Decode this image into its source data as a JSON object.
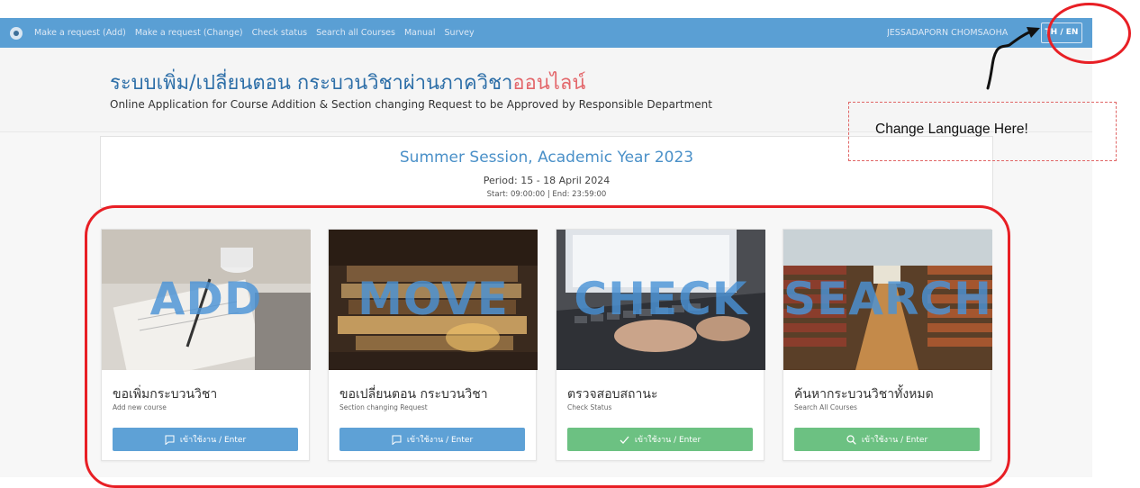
{
  "nav": {
    "links": [
      "Make a request (Add)",
      "Make a request (Change)",
      "Check status",
      "Search all Courses",
      "Manual",
      "Survey"
    ],
    "user": "JESSADAPORN CHOMSAOHA",
    "lang_th": "TH",
    "lang_sep": " / ",
    "lang_en": "EN"
  },
  "header": {
    "title_main": "ระบบเพิ่ม/เปลี่ยนตอน กระบวนวิชาผ่านภาควิชา",
    "title_accent": "ออนไลน์",
    "subtitle": "Online Application for Course Addition & Section changing Request to be Approved by Responsible Department"
  },
  "session": {
    "title": "Summer Session, Academic Year 2023",
    "period": "Period: 15 - 18 April 2024",
    "time": "Start: 09:00:00 | End: 23:59:00"
  },
  "cards": [
    {
      "word": "ADD",
      "title": "ขอเพิ่มกระบวนวิชา",
      "subtitle": "Add new course",
      "button": "เข้าใช้งาน / Enter",
      "icon": "comment-icon",
      "color": "#5ea1d6"
    },
    {
      "word": "MOVE",
      "title": "ขอเปลี่ยนตอน กระบวนวิชา",
      "subtitle": "Section changing Request",
      "button": "เข้าใช้งาน / Enter",
      "icon": "comment-icon",
      "color": "#5ea1d6"
    },
    {
      "word": "CHECK",
      "title": "ตรวจสอบสถานะ",
      "subtitle": "Check Status",
      "button": "เข้าใช้งาน / Enter",
      "icon": "checkmark-icon",
      "color": "#6cc182"
    },
    {
      "word": "SEARCH",
      "title": "ค้นหากระบวนวิชาทั้งหมด",
      "subtitle": "Search All Courses",
      "button": "เข้าใช้งาน / Enter",
      "icon": "search-icon",
      "color": "#6cc182"
    }
  ],
  "annotation": {
    "text": "Change Language Here!",
    "color": "#e81f25"
  }
}
